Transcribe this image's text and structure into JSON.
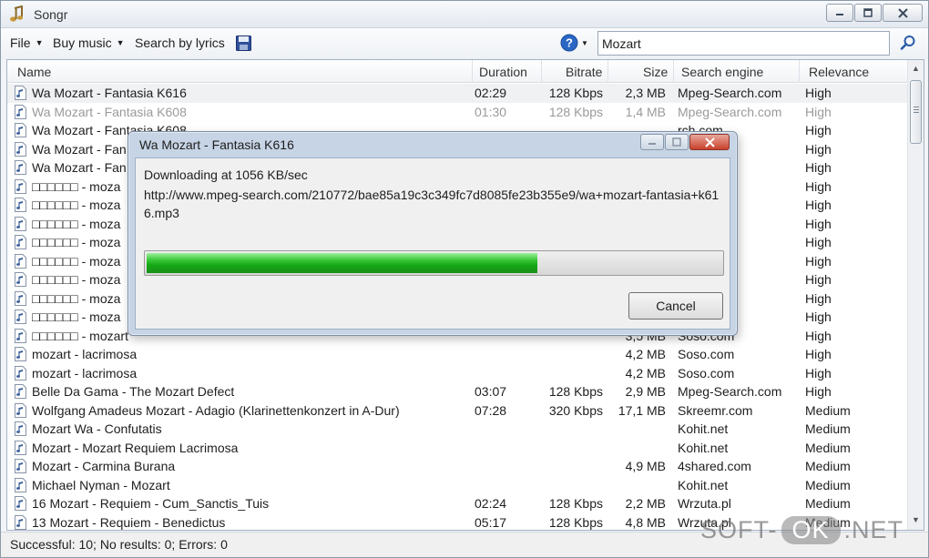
{
  "window": {
    "title": "Songr"
  },
  "toolbar": {
    "file_label": "File",
    "buy_music_label": "Buy music",
    "search_lyrics_label": "Search by lyrics",
    "search_value": "Mozart"
  },
  "list": {
    "columns": [
      "Name",
      "Duration",
      "Bitrate",
      "Size",
      "Search engine",
      "Relevance"
    ],
    "rows": [
      {
        "name": "Wa Mozart - Fantasia K616",
        "duration": "02:29",
        "bitrate": "128 Kbps",
        "size": "2,3 MB",
        "engine": "Mpeg-Search.com",
        "relevance": "High"
      },
      {
        "name": "Wa Mozart - Fantasia K608",
        "duration": "01:30",
        "bitrate": "128 Kbps",
        "size": "1,4 MB",
        "engine": "Mpeg-Search.com",
        "relevance": "High"
      },
      {
        "name": "Wa Mozart - Fantasia K608",
        "duration": "",
        "bitrate": "",
        "size": "",
        "engine": "rch.com",
        "relevance": "High"
      },
      {
        "name": "Wa Mozart - Fan",
        "duration": "",
        "bitrate": "",
        "size": "",
        "engine": "rch.com",
        "relevance": "High"
      },
      {
        "name": "Wa Mozart - Fan",
        "duration": "",
        "bitrate": "",
        "size": "",
        "engine": "rch.com",
        "relevance": "High"
      },
      {
        "name": "□□□□□□ - moza",
        "duration": "",
        "bitrate": "",
        "size": "",
        "engine": "",
        "relevance": "High"
      },
      {
        "name": "□□□□□□ - moza",
        "duration": "",
        "bitrate": "",
        "size": "",
        "engine": "",
        "relevance": "High"
      },
      {
        "name": "□□□□□□ - moza",
        "duration": "",
        "bitrate": "",
        "size": "",
        "engine": "",
        "relevance": "High"
      },
      {
        "name": "□□□□□□ - moza",
        "duration": "",
        "bitrate": "",
        "size": "",
        "engine": "",
        "relevance": "High"
      },
      {
        "name": "□□□□□□ - moza",
        "duration": "",
        "bitrate": "",
        "size": "",
        "engine": "",
        "relevance": "High"
      },
      {
        "name": "□□□□□□ - moza",
        "duration": "",
        "bitrate": "",
        "size": "",
        "engine": "",
        "relevance": "High"
      },
      {
        "name": "□□□□□□ - moza",
        "duration": "",
        "bitrate": "",
        "size": "",
        "engine": "",
        "relevance": "High"
      },
      {
        "name": "□□□□□□ - moza",
        "duration": "",
        "bitrate": "",
        "size": "",
        "engine": "",
        "relevance": "High"
      },
      {
        "name": "□□□□□□ - mozart",
        "duration": "",
        "bitrate": "",
        "size": "3,5 MB",
        "engine": "Soso.com",
        "relevance": "High"
      },
      {
        "name": "mozart - lacrimosa",
        "duration": "",
        "bitrate": "",
        "size": "4,2 MB",
        "engine": "Soso.com",
        "relevance": "High"
      },
      {
        "name": "mozart - lacrimosa",
        "duration": "",
        "bitrate": "",
        "size": "4,2 MB",
        "engine": "Soso.com",
        "relevance": "High"
      },
      {
        "name": "Belle Da Gama - The Mozart Defect",
        "duration": "03:07",
        "bitrate": "128 Kbps",
        "size": "2,9 MB",
        "engine": "Mpeg-Search.com",
        "relevance": "High"
      },
      {
        "name": "Wolfgang Amadeus Mozart - Adagio (Klarinettenkonzert in A-Dur)",
        "duration": "07:28",
        "bitrate": "320 Kbps",
        "size": "17,1 MB",
        "engine": "Skreemr.com",
        "relevance": "Medium"
      },
      {
        "name": "Mozart Wa - Confutatis",
        "duration": "",
        "bitrate": "",
        "size": "",
        "engine": "Kohit.net",
        "relevance": "Medium"
      },
      {
        "name": "Mozart - Mozart Requiem Lacrimosa",
        "duration": "",
        "bitrate": "",
        "size": "",
        "engine": "Kohit.net",
        "relevance": "Medium"
      },
      {
        "name": "Mozart - Carmina Burana",
        "duration": "",
        "bitrate": "",
        "size": "4,9 MB",
        "engine": "4shared.com",
        "relevance": "Medium"
      },
      {
        "name": "Michael Nyman - Mozart",
        "duration": "",
        "bitrate": "",
        "size": "",
        "engine": "Kohit.net",
        "relevance": "Medium"
      },
      {
        "name": "16 Mozart - Requiem - Cum_Sanctis_Tuis",
        "duration": "02:24",
        "bitrate": "128 Kbps",
        "size": "2,2 MB",
        "engine": "Wrzuta.pl",
        "relevance": "Medium"
      },
      {
        "name": "13 Mozart - Requiem - Benedictus",
        "duration": "05:17",
        "bitrate": "128 Kbps",
        "size": "4,8 MB",
        "engine": "Wrzuta.pl",
        "relevance": "Medium"
      }
    ]
  },
  "status": {
    "text": "Successful: 10; No results: 0; Errors: 0"
  },
  "dialog": {
    "title": "Wa Mozart - Fantasia K616",
    "status_text": "Downloading at 1056 KB/sec",
    "url": "http://www.mpeg-search.com/210772/bae85a19c3c349fc7d8085fe23b355e9/wa+mozart-fantasia+k616.mp3",
    "progress_fraction": 0.68,
    "cancel_label": "Cancel"
  },
  "watermark": {
    "left": "SOFT-",
    "pill": "OK",
    "right": ".NET"
  },
  "icons": {
    "app": "music-note-icon",
    "save": "floppy-disk-icon",
    "help": "help-icon",
    "search": "magnifier-icon",
    "file": "audio-file-icon"
  },
  "colors": {
    "progress": "#22b322",
    "dialog_frame": "#c6d4e5",
    "close_button": "#c9402b"
  }
}
